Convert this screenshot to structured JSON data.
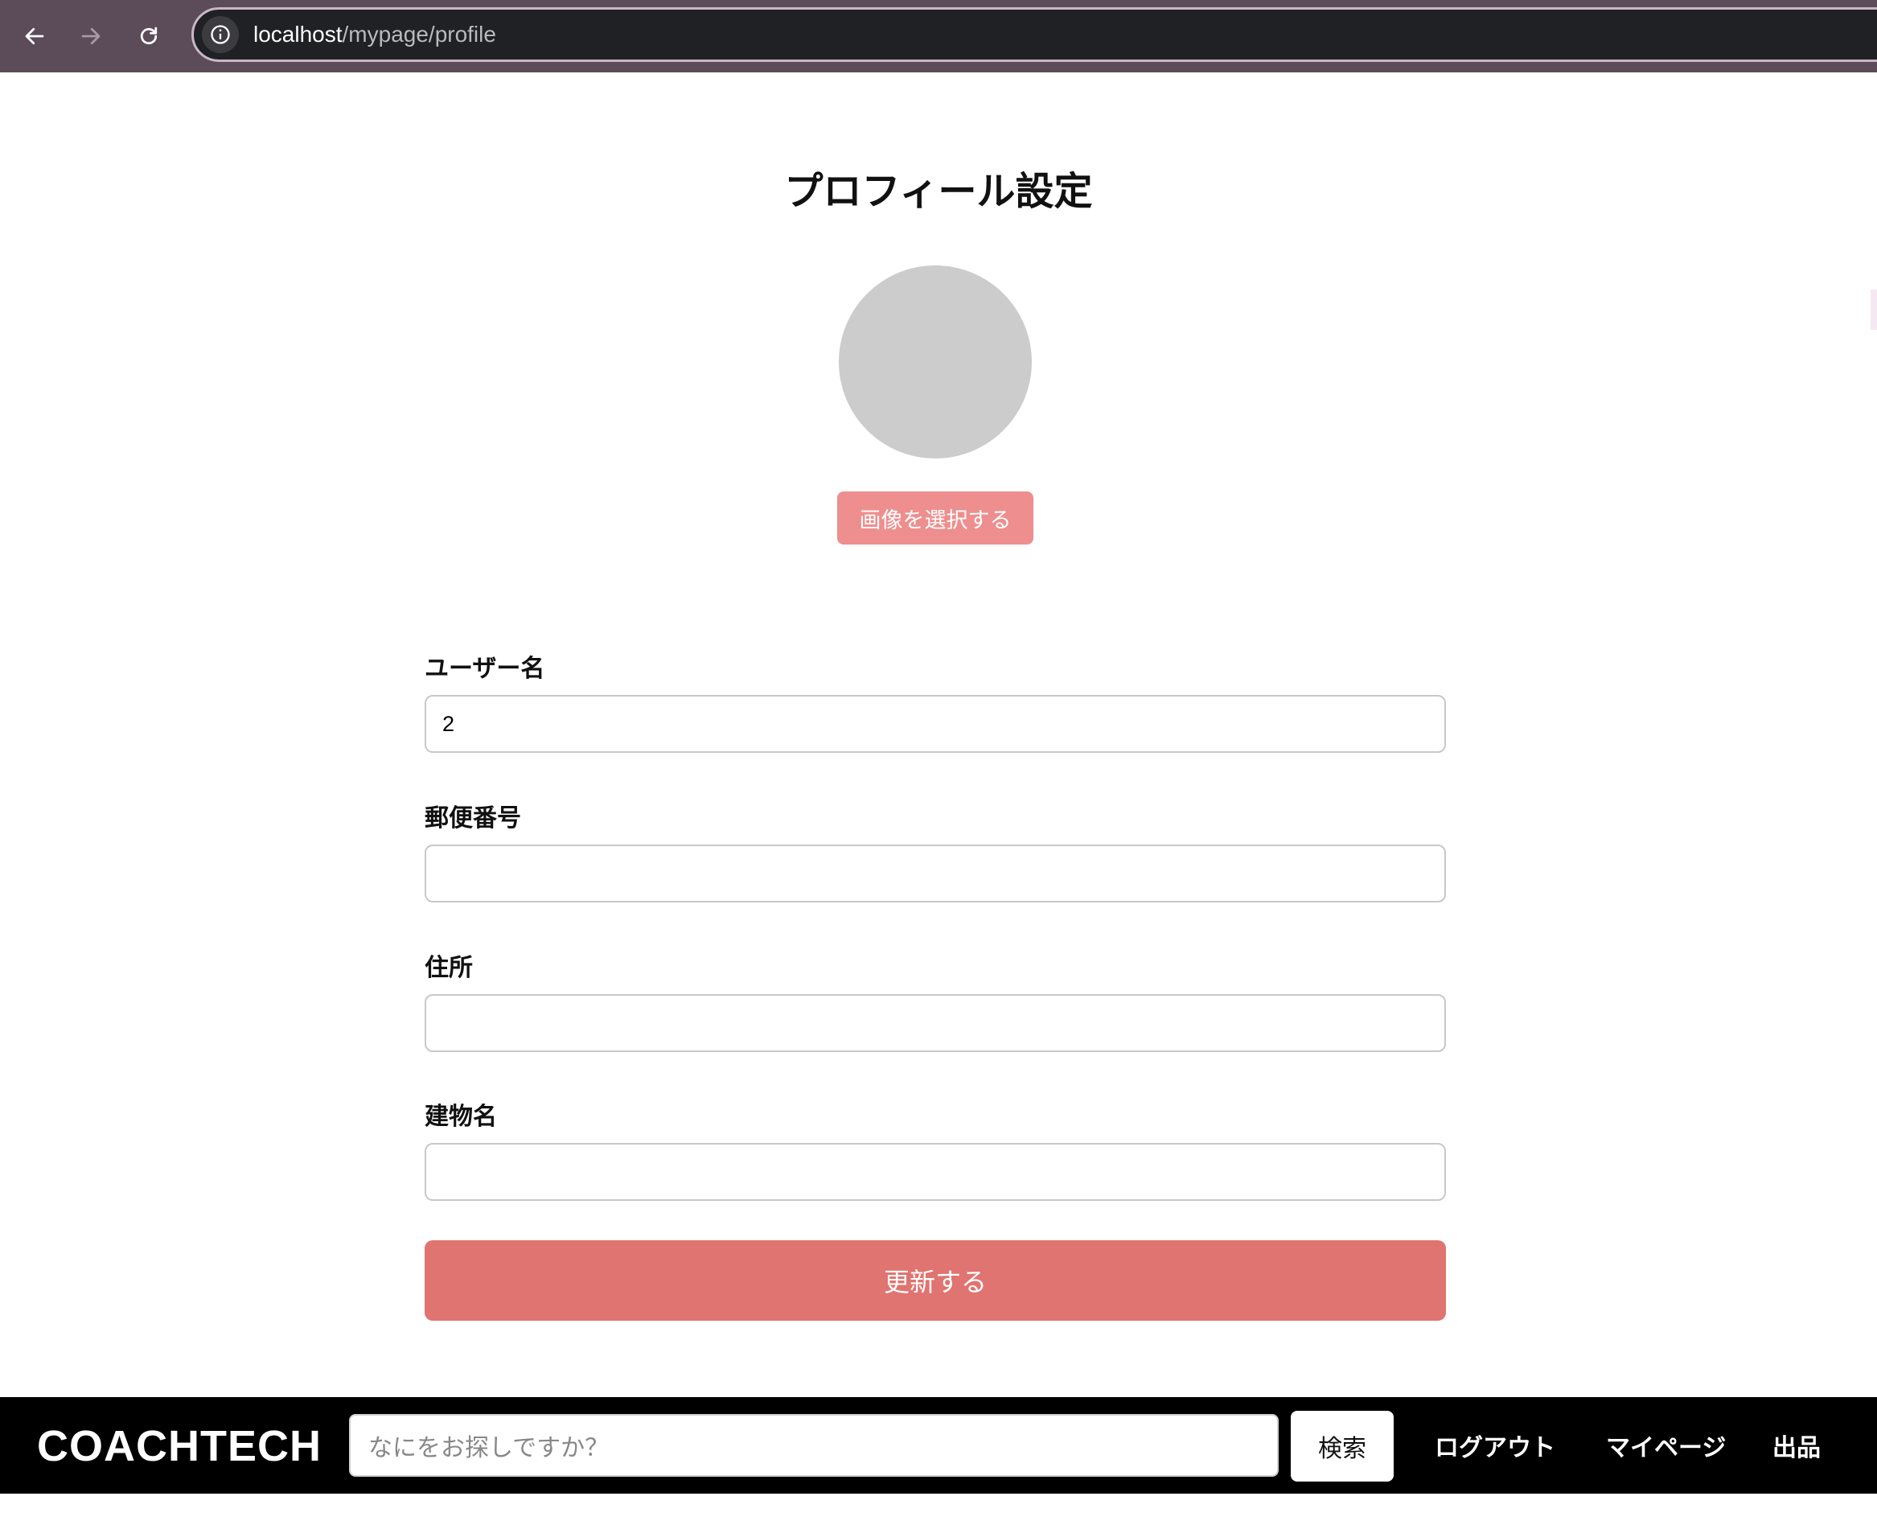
{
  "browser": {
    "url_host": "localhost",
    "url_path": "/mypage/profile"
  },
  "page": {
    "title": "プロフィール設定",
    "select_image_label": "画像を選択する",
    "fields": [
      {
        "label": "ユーザー名",
        "value": "2"
      },
      {
        "label": "郵便番号",
        "value": ""
      },
      {
        "label": "住所",
        "value": ""
      },
      {
        "label": "建物名",
        "value": ""
      }
    ],
    "update_label": "更新する"
  },
  "header": {
    "logo": "COACHTECH",
    "search_placeholder": "なにをお探しですか？",
    "search_button": "検索",
    "nav": {
      "logout": "ログアウト",
      "mypage": "マイページ",
      "sell": "出品"
    }
  },
  "colors": {
    "select_image_button": "#ee8e8e",
    "update_button": "#e07470",
    "avatar_placeholder": "#cccccc",
    "header_bg": "#000000"
  }
}
